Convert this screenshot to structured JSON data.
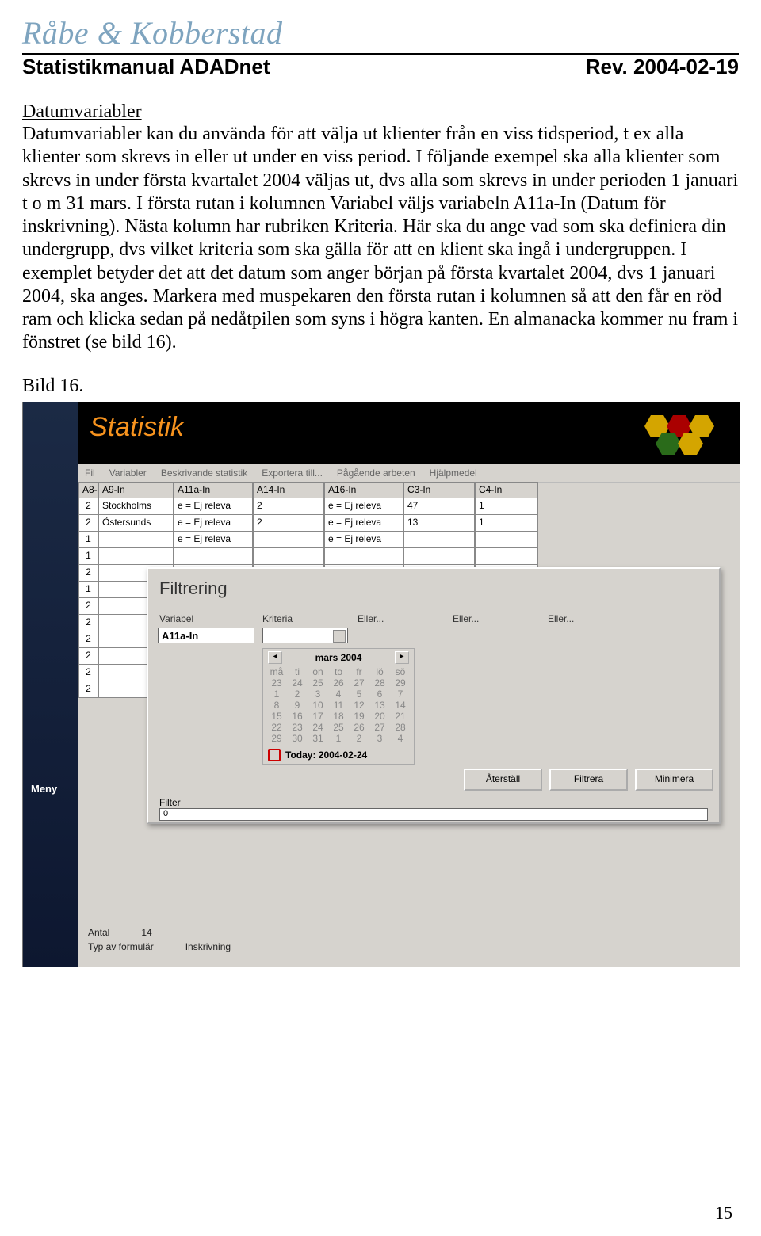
{
  "brand": "Råbe & Kobberstad",
  "doc_title": "Statistikmanual ADADnet",
  "revision": "Rev. 2004-02-19",
  "section_heading": "Datumvariabler",
  "body_text": "Datumvariabler kan du använda för att välja ut klienter från en viss tidsperiod, t ex alla klienter som skrevs in eller ut under en viss period. I följande exempel ska alla klienter som skrevs in under första kvartalet 2004 väljas ut, dvs alla som skrevs in under perioden 1 januari t o m 31 mars. I första rutan i kolumnen Variabel väljs variabeln A11a-In (Datum för inskrivning). Nästa kolumn har rubriken Kriteria. Här ska du ange vad som ska definiera din undergrupp, dvs vilket kriteria som ska gälla för att en klient ska ingå i undergruppen. I exemplet betyder det att det datum som anger början på första kvartalet 2004, dvs 1 januari 2004, ska anges. Markera med muspekaren den första rutan i kolumnen så att den får en röd ram och klicka sedan på nedåtpilen som syns i högra kanten. En almanacka kommer nu fram i fönstret (se bild 16).",
  "caption": "Bild 16.",
  "page_number": "15",
  "screenshot": {
    "app_title": "Statistik",
    "side_menu_label": "Meny",
    "menubar": [
      "Fil",
      "Variabler",
      "Beskrivande statistik",
      "Exportera till...",
      "Pågående arbeten",
      "Hjälpmedel"
    ],
    "grid_headers": [
      "A8-In",
      "A9-In",
      "A11a-In",
      "A14-In",
      "A16-In",
      "C3-In",
      "C4-In"
    ],
    "grid_rows": [
      [
        "2",
        "Stockholms",
        "e = Ej releva",
        "2",
        "e = Ej releva",
        "47",
        "1"
      ],
      [
        "2",
        "Östersunds",
        "e = Ej releva",
        "2",
        "e = Ej releva",
        "13",
        "1"
      ],
      [
        "1",
        "",
        "e = Ej releva",
        "",
        "e = Ej releva",
        "",
        ""
      ],
      [
        "1",
        "",
        "",
        "",
        "",
        "",
        ""
      ],
      [
        "2",
        "",
        "",
        "",
        "",
        "",
        ""
      ],
      [
        "1",
        "",
        "",
        "",
        "",
        "",
        ""
      ],
      [
        "2",
        "",
        "",
        "",
        "",
        "",
        ""
      ],
      [
        "2",
        "",
        "",
        "",
        "",
        "",
        ""
      ],
      [
        "2",
        "",
        "",
        "",
        "",
        "",
        ""
      ],
      [
        "2",
        "",
        "",
        "",
        "",
        "",
        ""
      ],
      [
        "2",
        "",
        "",
        "",
        "",
        "",
        ""
      ],
      [
        "2",
        "",
        "",
        "",
        "",
        "",
        ""
      ]
    ],
    "dialog": {
      "title": "Filtrering",
      "columns": [
        "Variabel",
        "Kriteria",
        "Eller...",
        "Eller...",
        "Eller..."
      ],
      "variable_value": "A11a-In",
      "calendar": {
        "month_label": "mars 2004",
        "day_headers": [
          "må",
          "ti",
          "on",
          "to",
          "fr",
          "lö",
          "sö"
        ],
        "cells": [
          "23",
          "24",
          "25",
          "26",
          "27",
          "28",
          "29",
          "1",
          "2",
          "3",
          "4",
          "5",
          "6",
          "7",
          "8",
          "9",
          "10",
          "11",
          "12",
          "13",
          "14",
          "15",
          "16",
          "17",
          "18",
          "19",
          "20",
          "21",
          "22",
          "23",
          "24",
          "25",
          "26",
          "27",
          "28",
          "29",
          "30",
          "31",
          "1",
          "2",
          "3",
          "4"
        ],
        "today_label": "Today: 2004-02-24"
      },
      "buttons": {
        "reset": "Återställ",
        "filter": "Filtrera",
        "minimize": "Minimera"
      },
      "filter_label": "Filter",
      "filter_value": "0"
    },
    "footer": {
      "antal_label": "Antal",
      "antal_value": "14",
      "typ_label": "Typ av formulär",
      "typ_value": "Inskrivning"
    }
  }
}
